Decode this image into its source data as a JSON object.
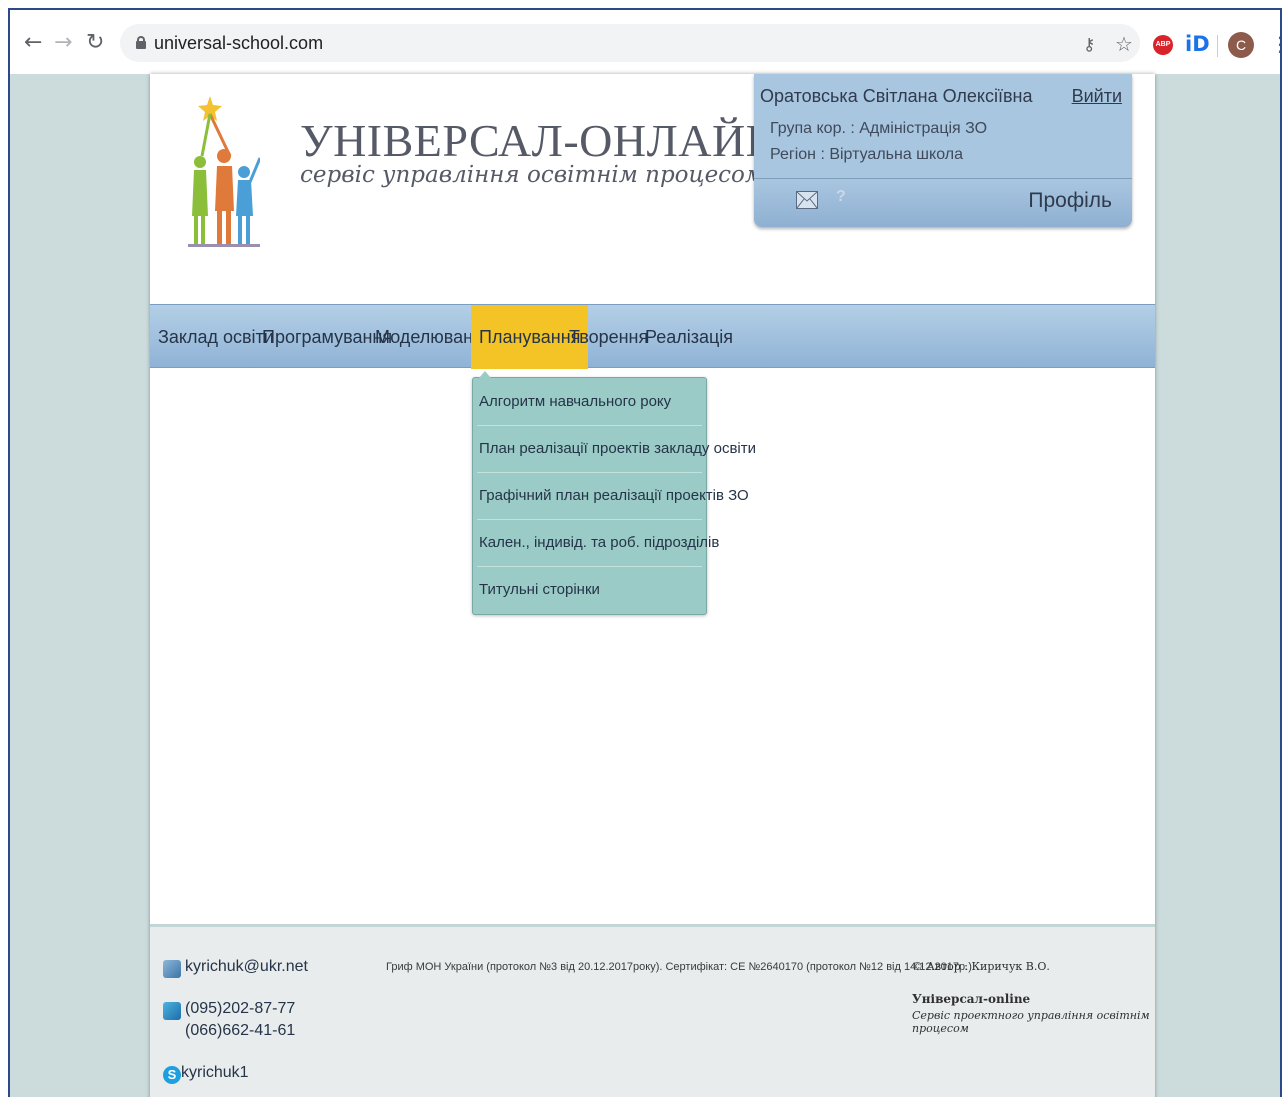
{
  "browser": {
    "url": "universal-school.com",
    "avatar_letter": "C",
    "abp_label": "ABP",
    "id_label": "iD"
  },
  "header": {
    "title": "УНІВЕРСАЛ-ОНЛАЙН",
    "subtitle": "сервіс управління освітнім процесом"
  },
  "user": {
    "name": "Оратовська Світлана Олексіївна",
    "logout": "Вийти",
    "group": "Група кор. : Адміністрація ЗО",
    "region": "Регіон : Віртуальна школа",
    "profile": "Профіль"
  },
  "nav": {
    "items": [
      "Заклад освіти",
      "Програмування",
      "Моделювання",
      "Планування",
      "Творення",
      "Реалізація"
    ],
    "active": "Планування"
  },
  "dropdown": {
    "items": [
      "Алгоритм навчального року",
      "План реалізації проектів закладу освіти",
      "Графічний план реалізації проектів ЗО",
      "Кален., індивід. та роб. підрозділів",
      "Титульні сторінки"
    ]
  },
  "footer": {
    "email": "kyrichuk@ukr.net",
    "phone1": "(095)202-87-77",
    "phone2": "(066)662-41-61",
    "skype": "kyrichuk1",
    "certification": "Гриф МОН України (протокол №3 від 20.12.2017року). Сертифікат: СЕ №2640170 (протокол №12 від 14.12.2017р.)",
    "author": "© Автор : Киричук В.О.",
    "brand": "Універсал-online",
    "slogan": "Сервіс проектного управління освітнім процесом"
  },
  "colors": {
    "nav_active": "#f4c325",
    "dropdown_bg": "#9bcbc6",
    "user_panel": "#a9c6e0",
    "page_bg": "#ccdcdc"
  }
}
